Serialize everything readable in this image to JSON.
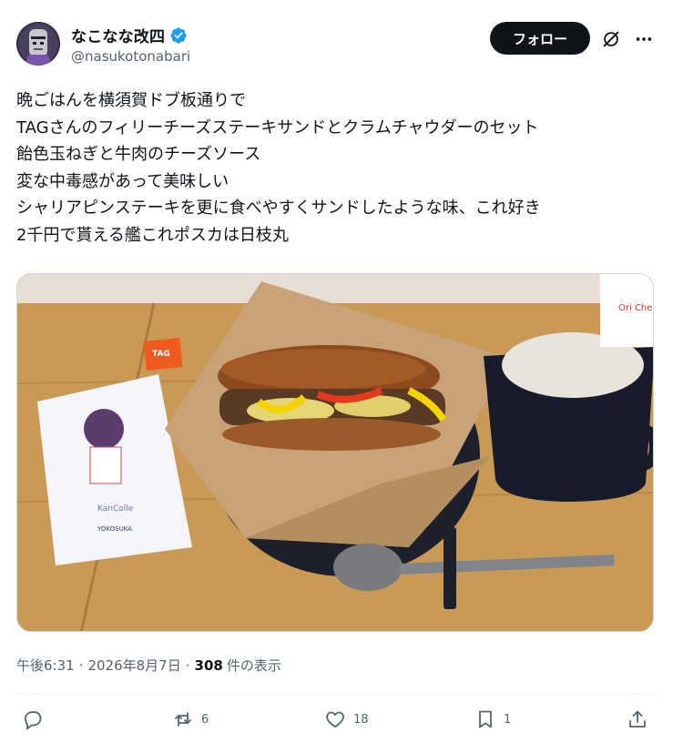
{
  "user": {
    "display_name": "なこなな改四",
    "handle": "@nasukotonabari",
    "verified": true,
    "follow_label": "フォロー"
  },
  "tweet": {
    "lines": [
      "晩ごはんを横須賀ドブ板通りで",
      "TAGさんのフィリーチーズステーキサンドとクラムチャウダーのセット",
      "飴色玉ねぎと牛肉のチーズソース",
      "変な中毒感があって美味しい",
      "シャリアピンステーキを更に食べやすくサンドしたような味、これ好き",
      "2千円で貰える艦これポスカは日枝丸"
    ],
    "media": {
      "card_kancolle": "KanColle",
      "card_yokosuka": "YOKOSUKA",
      "tag_label": "TAG",
      "box_text": "Ori Chee"
    },
    "meta": {
      "time": "午後6:31",
      "date": "2026年8月7日",
      "views_count": "308",
      "views_label": "件の表示",
      "separator": "·"
    },
    "actions": {
      "reply_count": "",
      "retweet_count": "6",
      "like_count": "18",
      "bookmark_count": "1"
    }
  },
  "colors": {
    "text_primary": "#0f1419",
    "text_secondary": "#536471",
    "verified_blue": "#1d9bf0",
    "follow_bg": "#0f1419"
  },
  "icons": [
    "verified-badge-icon",
    "grok-icon",
    "more-icon",
    "reply-icon",
    "retweet-icon",
    "like-icon",
    "bookmark-icon",
    "share-icon"
  ]
}
